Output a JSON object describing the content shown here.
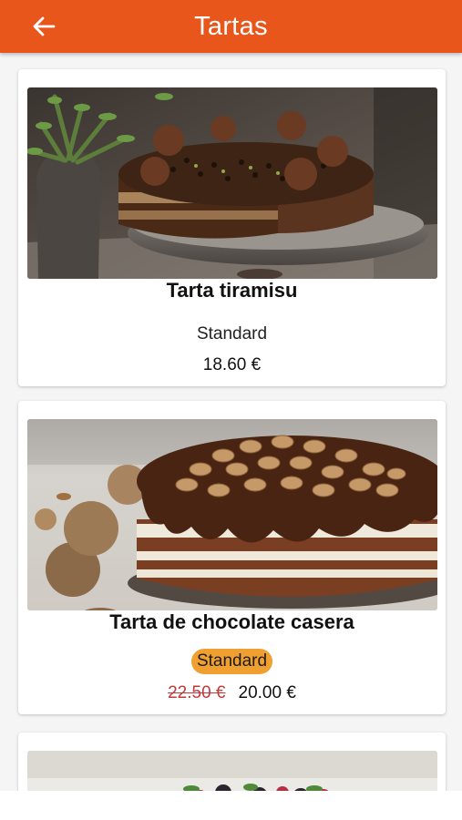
{
  "header": {
    "title": "Tartas",
    "back_icon": "arrow-left-icon",
    "background_color": "#e8561b"
  },
  "products": [
    {
      "name": "Tarta tiramisu",
      "size": "Standard",
      "price": "18.60 €"
    },
    {
      "name": "Tarta de chocolate casera",
      "size": "Standard",
      "old_price": "22.50 €",
      "price": "20.00 €"
    }
  ],
  "colors": {
    "accent": "#e8561b",
    "size_chip": "#f0a030",
    "old_price": "#c0393b"
  }
}
